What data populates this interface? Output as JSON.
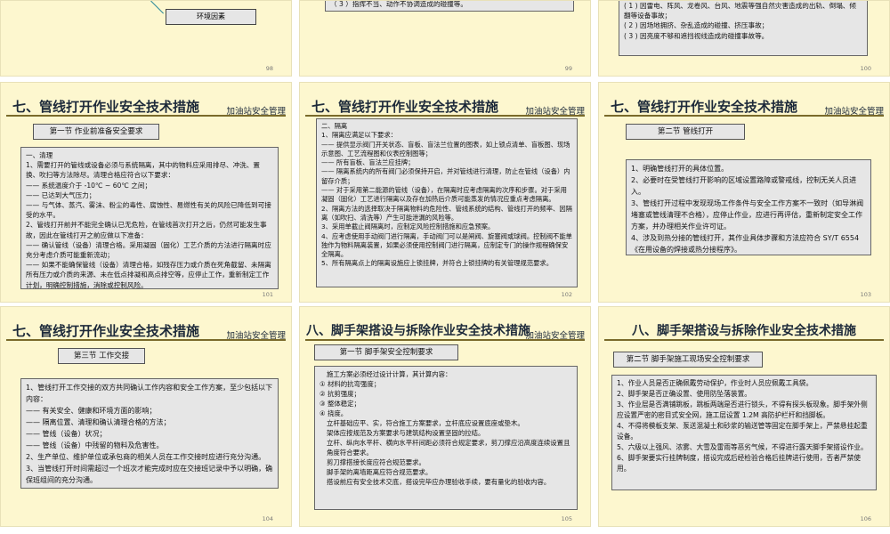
{
  "org_label": "加油站安全管理",
  "top": {
    "s98": {
      "env": "环境因素",
      "page": "98"
    },
    "s99": {
      "line": "（ 3 ）指挥不当、动作不协调造成的碰撞等。",
      "page": "99"
    },
    "s100": {
      "lines": [
        "( 1 ) 因雷电、阵风、龙卷风、台风、地震等强自然灾害造成的出轨、倒塌、倾翻等设备事故；",
        "( 2 ) 因场地拥挤、杂乱造成的碰撞、挤压事故；",
        "( 3 ) 因亮度不够和遮挡视线造成的碰撞事故等。"
      ],
      "page": "100"
    }
  },
  "s101": {
    "title": "七、管线打开作业安全技术措施",
    "section": "第一节 作业前准备安全要求",
    "lines": [
      "一、清理",
      "1、需要打开的管线或设备必须与系统隔离，其中的物料应采用排尽、冲洗、置换、吹扫等方法除尽。清理合格应符合以下要求：",
      "—— 系统温度介于 -10℃ ~ 60℃ 之间；",
      "—— 已达到大气压力；",
      "—— 与气体、蒸汽、雾沫、粉尘的毒性、腐蚀性、易燃性有关的风险已降低到可接受的水平。",
      "2、管线打开前并不能完全确认已无危险，在管线首次打开之后，仍然可能发生事故，因此在管线打开之前应做以下准备：",
      "—— 确认管线（设备）清理合格。采用凝固（固化）工艺介质的方法进行隔离时应充分考虑介质可能重新流动；",
      "—— 如果不能确保管线（设备）清理合格，如残存压力或介质在死角截留、未隔离所有压力或介质的来源、未在低点排凝和高点排空等，应停止工作，重新制定工作计划，明确控制措施，消除或控制风险。"
    ],
    "page": "101"
  },
  "s102": {
    "title": "七、管线打开作业安全技术措施",
    "lines": [
      "二、隔离",
      "1、隔离应满足以下要求：",
      "—— 提供显示阀门开关状态、盲板、盲法兰位置的图表，如上锁点清单、盲板图、现场示意图、工艺流程图和仪表控制图等；",
      "—— 所有盲板、盲法兰应挂牌；",
      "—— 隔离系统内的所有阀门必须保持开启，并对管线进行清理，防止在管线（设备）内留存介质；",
      "—— 对于采用第二能源的管线（设备），在隔离时应考虑隔离的次序和步骤。对于采用凝固（固化）工艺进行隔离以及存在加热后介质可能蒸发的情况应重点考虑隔离。",
      "2、隔离方法的选择取决于隔离物料的危险性、管线系统的结构、管线打开的频率、因隔离（如吹扫、清洗等）产生可能泄漏的风险等。",
      "3、采用单截止阀隔离时，应制定风险控制措施和应急预案。",
      "4、应考虑使用手动阀门进行隔离，手动阀门可以是闸阀、旋塞阀或球阀。控制阀不能单独作为物料隔离装置，如果必须使用控制阀门进行隔离，应制定专门的操作规程确保安全隔离。",
      "5、所有隔离点上的隔离设施应上锁挂牌，并符合上锁挂牌的有关管理规范要求。"
    ],
    "page": "102"
  },
  "s103": {
    "title": "七、管线打开作业安全技术措施",
    "section": "第二节 管线打开",
    "lines": [
      "1、明确管线打开的具体位置。",
      "2、必要时在受管线打开影响的区域设置路障或警戒线，控制无关人员进入。",
      "3、管线打开过程中发现现场工作条件与安全工作方案不一致时（如导淋阀堵塞或管线清理不合格），应停止作业，应进行再评估，重新制定安全工作方案，并办理相关作业许可证。",
      "4、涉及到热分接的管线打开，其作业具体步骤和方法应符合 SY/T 6554《在用设备的焊接或热分接程序》。"
    ],
    "page": "103"
  },
  "s104": {
    "title": "七、管线打开作业安全技术措施",
    "section": "第三节 工作交接",
    "lines": [
      "1、管线打开工作交接的双方共同确认工作内容和安全工作方案，至少包括以下内容：",
      "—— 有关安全、健康和环境方面的影响；",
      "—— 隔离位置、清理和确认清理合格的方法；",
      "—— 管线（设备）状况；",
      "—— 管线（设备）中残留的物料及危害性。",
      "2、生产单位、维护单位或承包商的相关人员在工作交接时应进行充分沟通。",
      "3、当管线打开时间需超过一个班次才能完成时应在交接班记录中予以明确，确保班组间的充分沟通。"
    ],
    "page": "104"
  },
  "s105": {
    "title": "八、脚手架搭设与拆除作业安全技术措施",
    "section": "第一节 脚手架安全控制要求",
    "lines": [
      "施工方案必须经过设计计算，其计算内容：",
      "① 材料的抗弯强度；",
      "② 抗剪强度；",
      "③ 整体稳定；",
      "④ 挠度。",
      "立杆基础应平、实，符合施工方案要求，立杆底应设置底座或垫木。",
      "架体应按规范及方案要求与建筑结构设置坚固的拉结。",
      "立杆、纵向水平杆、横向水平杆间距必须符合规定要求，剪刀撑应沿高度连续设置且角度符合要求。",
      "剪刀撑搭接长度应符合规范要求。",
      "脚手架的离墙距离应符合规范要求。",
      "搭设前应有安全技术交底，搭设完毕应办理验收手续，要有量化的验收内容。"
    ],
    "page": "105"
  },
  "s106": {
    "title": "八、脚手架搭设与拆除作业安全技术措施",
    "section": "第二节 脚手架施工现场安全控制要求",
    "lines": [
      "1、作业人员是否正确佩戴劳动保护，作业时人员应佩戴工具袋。",
      "2、脚手架是否正确设置、使用防坠落装置。",
      "3、作业层是否满铺跳板，跳板两端是否进行锁头，不得有探头板现象。脚手架外侧应设置严密的密目式安全网，施工层设置 1.2M 高防护栏杆和挡脚板。",
      "4、不得将模板支架、泵送混凝土和砂浆的输送管等固定在脚手架上，严禁悬挂起重设备。",
      "5、六级以上强风、浓雾、大雪及雷雨等恶劣气候，不得进行露天脚手架搭设作业。",
      "6、脚手架要实行挂牌制度，搭设完成后经检验合格后挂牌进行使用，否者严禁使用。"
    ],
    "page": "106"
  }
}
